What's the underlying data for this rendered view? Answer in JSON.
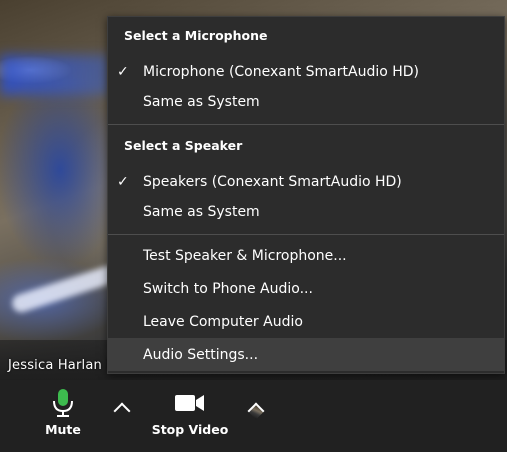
{
  "participant": {
    "name": "Jessica Harlan Phipps"
  },
  "menu": {
    "microphone_heading": "Select a Microphone",
    "microphones": [
      {
        "label": "Microphone (Conexant SmartAudio HD)",
        "checked": true
      },
      {
        "label": "Same as System",
        "checked": false
      }
    ],
    "speaker_heading": "Select a Speaker",
    "speakers": [
      {
        "label": "Speakers (Conexant SmartAudio HD)",
        "checked": true
      },
      {
        "label": "Same as System",
        "checked": false
      }
    ],
    "actions": [
      {
        "label": "Test Speaker & Microphone..."
      },
      {
        "label": "Switch to Phone Audio..."
      },
      {
        "label": "Leave Computer Audio"
      },
      {
        "label": "Audio Settings...",
        "highlighted": true
      }
    ],
    "check_glyph": "✓"
  },
  "toolbar": {
    "mute_label": "Mute",
    "stop_video_label": "Stop Video"
  },
  "colors": {
    "mic_green": "#3dbb4e",
    "menu_bg": "#2c2c2c",
    "toolbar_bg": "#212121"
  },
  "icons": {
    "mute": "microphone-icon",
    "video": "video-camera-icon",
    "audio_options": "chevron-up-icon",
    "video_options": "chevron-up-icon",
    "checked": "checkmark-icon"
  }
}
